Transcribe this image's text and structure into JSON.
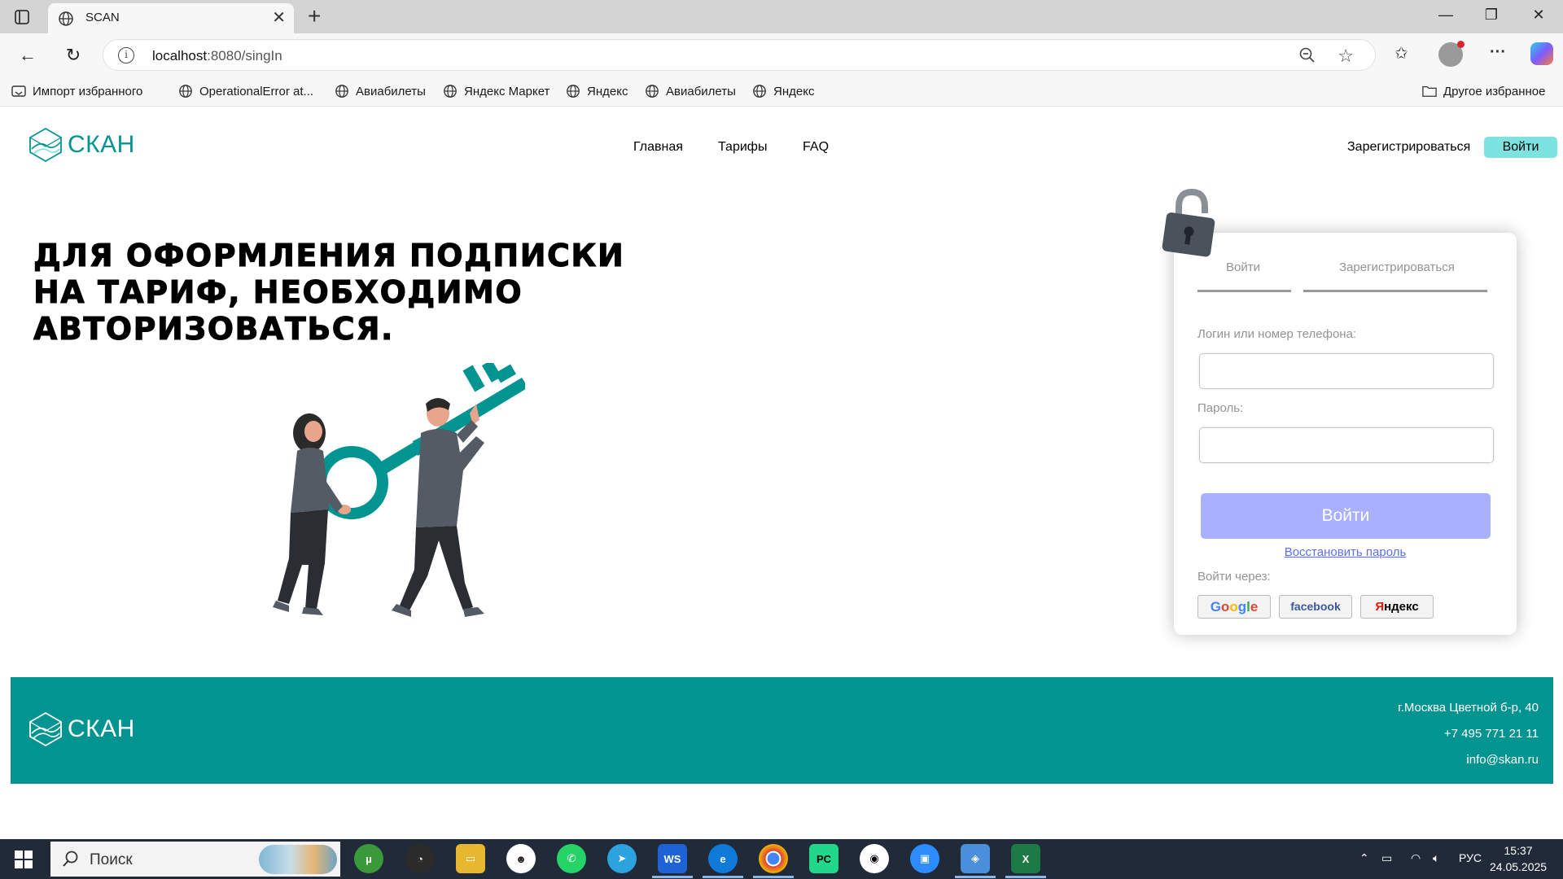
{
  "browser": {
    "tab_title": "SCAN",
    "url_host": "localhost",
    "url_path": ":8080/singIn",
    "bookmarks": [
      {
        "label": "Импорт избранного",
        "icon": "folder-import-icon"
      },
      {
        "label": "OperationalError at...",
        "icon": "globe-icon"
      },
      {
        "label": "Авиабилеты",
        "icon": "globe-icon"
      },
      {
        "label": "Яндекс Маркет",
        "icon": "globe-icon"
      },
      {
        "label": "Яндекс",
        "icon": "globe-icon"
      },
      {
        "label": "Авиабилеты",
        "icon": "globe-icon"
      },
      {
        "label": "Яндекс",
        "icon": "globe-icon"
      }
    ],
    "other_bookmarks": "Другое избранное"
  },
  "header": {
    "logo_text": "СКАН",
    "nav": [
      "Главная",
      "Тарифы",
      "FAQ"
    ],
    "register_label": "Зарегистрироваться",
    "login_label": "Войти"
  },
  "hero": {
    "headline": "Для оформления подписки на тариф, необходимо авторизоваться."
  },
  "auth": {
    "tab_login": "Войти",
    "tab_register": "Зарегистрироваться",
    "login_label": "Логин или номер телефона:",
    "login_value": "",
    "password_label": "Пароль:",
    "password_value": "",
    "submit_label": "Войти",
    "restore_label": "Восстановить пароль",
    "via_label": "Войти через:",
    "social": {
      "google": [
        "G",
        "o",
        "o",
        "g",
        "l",
        "e"
      ],
      "facebook": "facebook",
      "yandex_first": "Я",
      "yandex_rest": "ндекс"
    }
  },
  "footer": {
    "logo_text": "СКАН",
    "address": "г.Москва Цветной б-р, 40",
    "phone": "+7 495 771 21 11",
    "email": "info@skan.ru"
  },
  "taskbar": {
    "search_placeholder": "Поиск",
    "language": "РУС",
    "time": "15:37",
    "date": "24.05.2025"
  },
  "colors": {
    "brand_teal": "#029491",
    "login_btn": "#7ce3e1",
    "submit_disabled": "#a8b0ff",
    "link": "#5970ff"
  }
}
